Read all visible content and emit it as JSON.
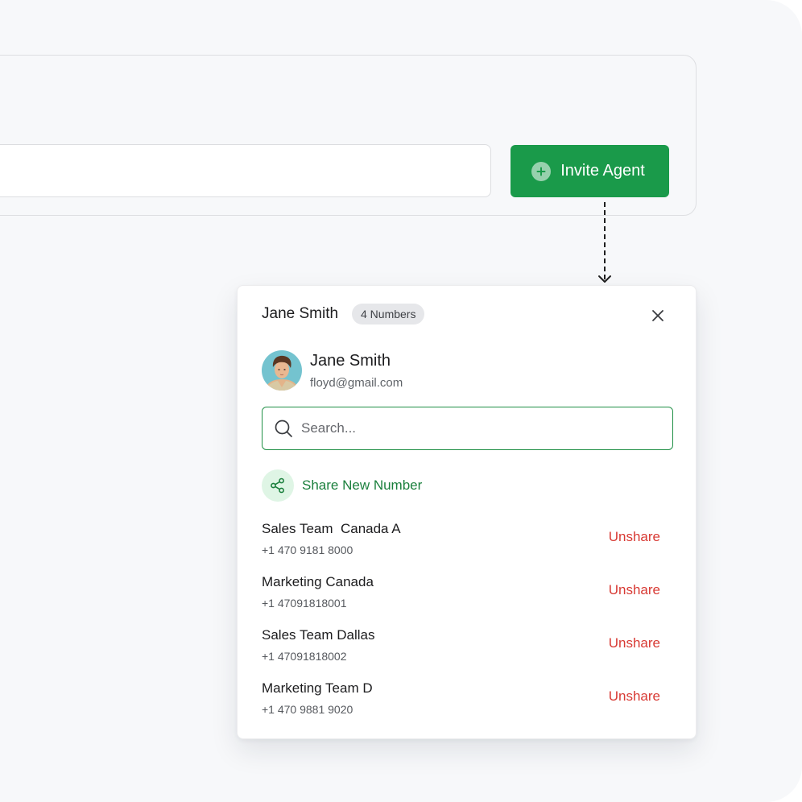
{
  "invite_button": {
    "label": "Invite Agent"
  },
  "panel": {
    "title": "Jane Smith",
    "badge": "4 Numbers",
    "user": {
      "name": "Jane Smith",
      "email": "floyd@gmail.com"
    },
    "search": {
      "placeholder": "Search..."
    },
    "share_new_label": "Share New Number",
    "unshare_label": "Unshare",
    "numbers": [
      {
        "name": "Sales Team  Canada A",
        "phone": "+1 470 9181 8000"
      },
      {
        "name": "Marketing Canada",
        "phone": "+1 47091818001"
      },
      {
        "name": "Sales Team Dallas",
        "phone": "+1 47091818002"
      },
      {
        "name": "Marketing Team D",
        "phone": "+1 470 9881 9020"
      }
    ]
  },
  "colors": {
    "primary_green": "#1a9a4a",
    "accent_green_text": "#1a7f3c",
    "danger_red": "#d83a34",
    "background": "#f7f8fa"
  },
  "icons": {
    "invite": "plus-circle-icon",
    "close": "close-icon",
    "search": "search-icon",
    "share": "share-icon"
  }
}
